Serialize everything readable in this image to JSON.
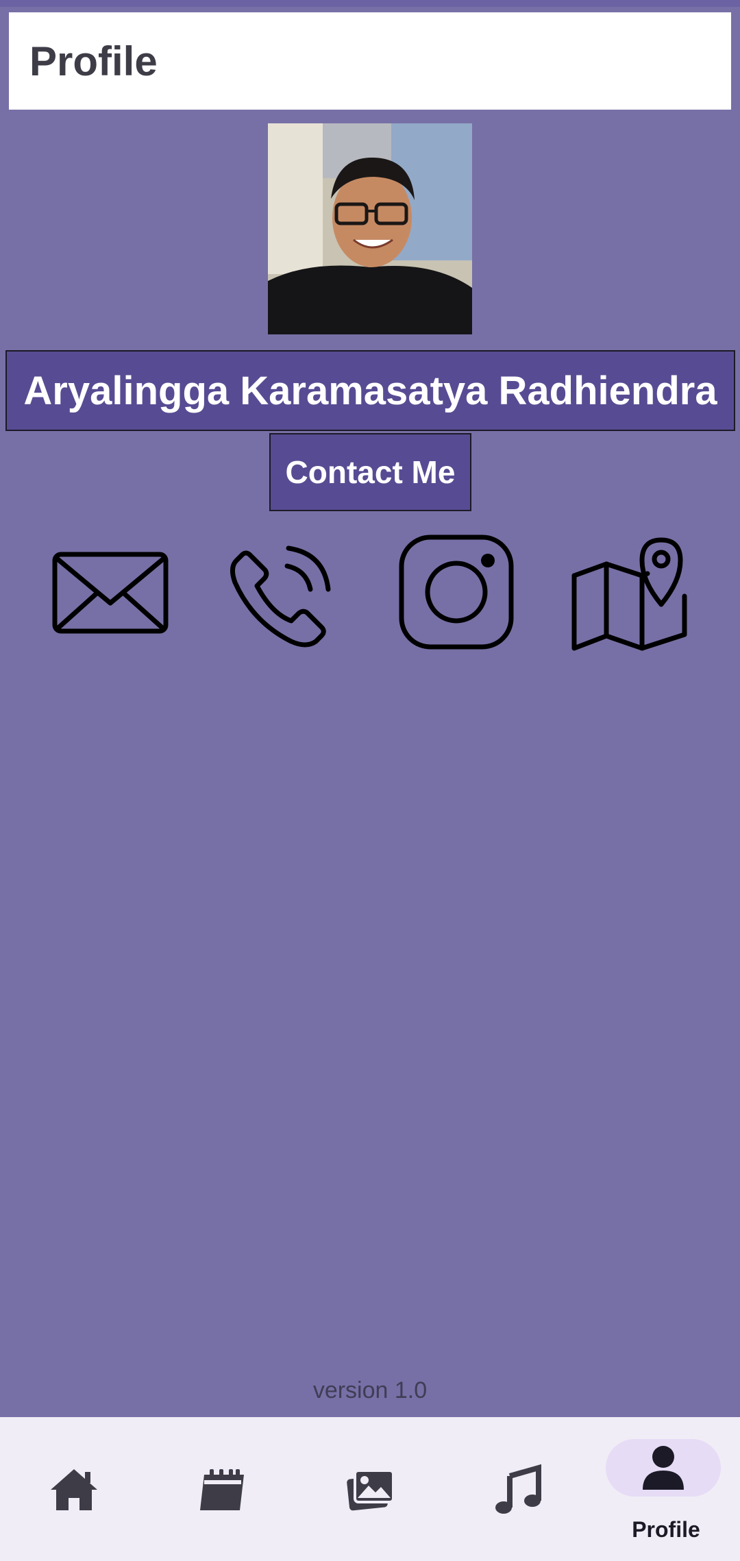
{
  "header": {
    "title": "Profile"
  },
  "profile": {
    "name": "Aryalingga Karamasatya Radhiendra",
    "contact_button": "Contact Me"
  },
  "contact_icons": [
    "email-icon",
    "phone-icon",
    "instagram-icon",
    "map-icon"
  ],
  "footer": {
    "version": "version 1.0"
  },
  "bottom_nav": {
    "items": [
      {
        "icon": "home-icon",
        "label": ""
      },
      {
        "icon": "calendar-icon",
        "label": ""
      },
      {
        "icon": "gallery-icon",
        "label": ""
      },
      {
        "icon": "music-icon",
        "label": ""
      },
      {
        "icon": "person-icon",
        "label": "Profile",
        "active": true
      }
    ]
  },
  "colors": {
    "background": "#7770a6",
    "accent": "#574c93",
    "header_bg": "#ffffff",
    "nav_bg": "#f1edf6",
    "active_pill": "#e6dcf6"
  }
}
